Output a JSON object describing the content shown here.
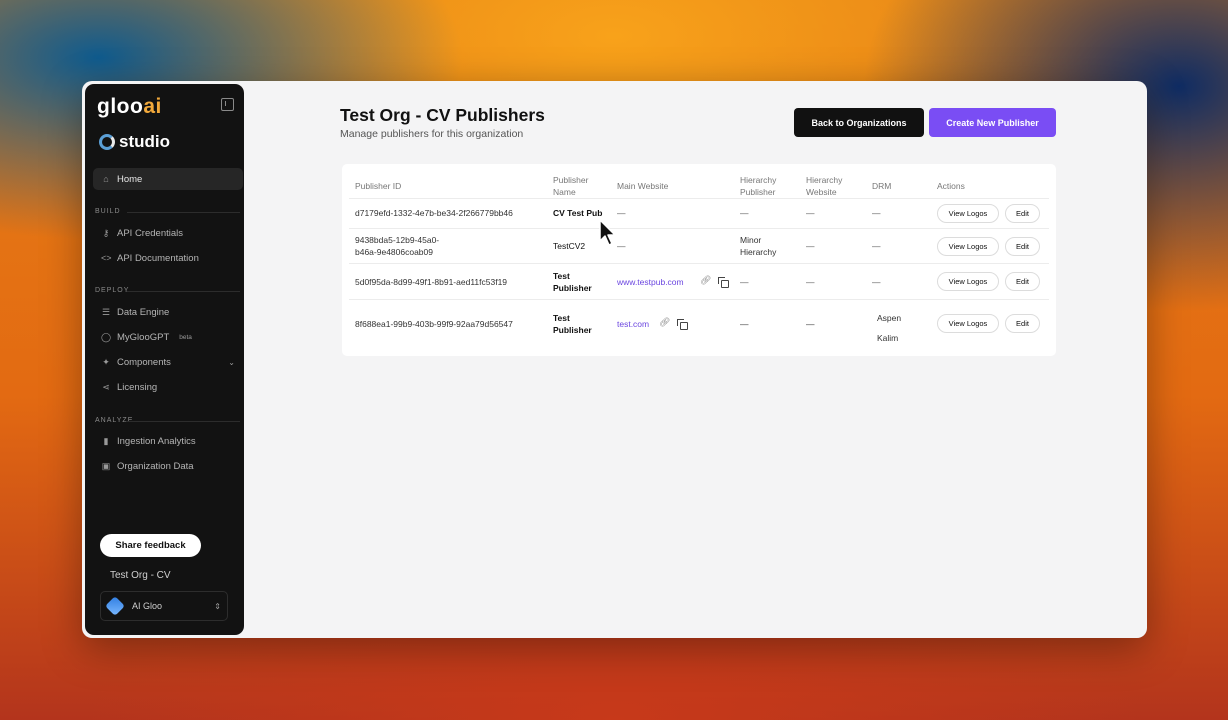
{
  "sidebar": {
    "brand_main": "gloo",
    "brand_accent": "ai",
    "studio_label": "studio",
    "home_label": "Home",
    "section_build": "BUILD",
    "api_credentials": "API Credentials",
    "api_documentation": "API Documentation",
    "section_deploy": "DEPLOY",
    "data_engine": "Data Engine",
    "mygloogpt": "MyGlooGPT",
    "beta_tag": "beta",
    "components": "Components",
    "licensing": "Licensing",
    "section_analyze": "ANALYZE",
    "ingestion_analytics": "Ingestion Analytics",
    "organization_data": "Organization Data",
    "share_feedback": "Share feedback",
    "org_name": "Test Org - CV",
    "user_name": "AI Gloo"
  },
  "header": {
    "title": "Test Org - CV Publishers",
    "subtitle": "Manage publishers for this organization",
    "back_button": "Back to Organizations",
    "create_button": "Create New Publisher"
  },
  "table": {
    "columns": {
      "publisher_id": "Publisher ID",
      "publisher_name_1": "Publisher",
      "publisher_name_2": "Name",
      "main_website": "Main Website",
      "hier_pub_1": "Hierarchy",
      "hier_pub_2": "Publisher",
      "hier_web_1": "Hierarchy",
      "hier_web_2": "Website",
      "drm": "DRM",
      "actions": "Actions"
    },
    "rows": [
      {
        "id_1": "d7179efd-1332-4e7b-be34-2f266779bb46",
        "id_2": "",
        "name_1": "CV Test Pub",
        "name_2": "",
        "website": "—",
        "hier_pub_1": "—",
        "hier_pub_2": "",
        "hier_web": "—",
        "drm_1": "—",
        "drm_2": "",
        "view_logos": "View Logos",
        "edit": "Edit"
      },
      {
        "id_1": "9438bda5-12b9-45a0-",
        "id_2": "b46a-9e4806coab09",
        "name_1": "TestCV2",
        "name_2": "",
        "website": "—",
        "hier_pub_1": "Minor",
        "hier_pub_2": "Hierarchy",
        "hier_web": "—",
        "drm_1": "—",
        "drm_2": "",
        "view_logos": "View Logos",
        "edit": "Edit"
      },
      {
        "id_1": "5d0f95da-8d99-49f1-8b91-aed11fc53f19",
        "id_2": "",
        "name_1": "Test",
        "name_2": "Publisher",
        "website": "www.testpub.com",
        "hier_pub_1": "—",
        "hier_pub_2": "",
        "hier_web": "—",
        "drm_1": "—",
        "drm_2": "",
        "view_logos": "View Logos",
        "edit": "Edit"
      },
      {
        "id_1": "8f688ea1-99b9-403b-99f9-92aa79d56547",
        "id_2": "",
        "name_1": "Test",
        "name_2": "Publisher",
        "website": "test.com",
        "hier_pub_1": "—",
        "hier_pub_2": "",
        "hier_web": "—",
        "drm_1": "Aspen",
        "drm_2": "Kalim",
        "view_logos": "View Logos",
        "edit": "Edit"
      }
    ]
  },
  "colors": {
    "accent": "#7a4df4",
    "sidebar_bg": "#121212",
    "link": "#6b46e0",
    "brand_accent": "#f2a93b"
  }
}
